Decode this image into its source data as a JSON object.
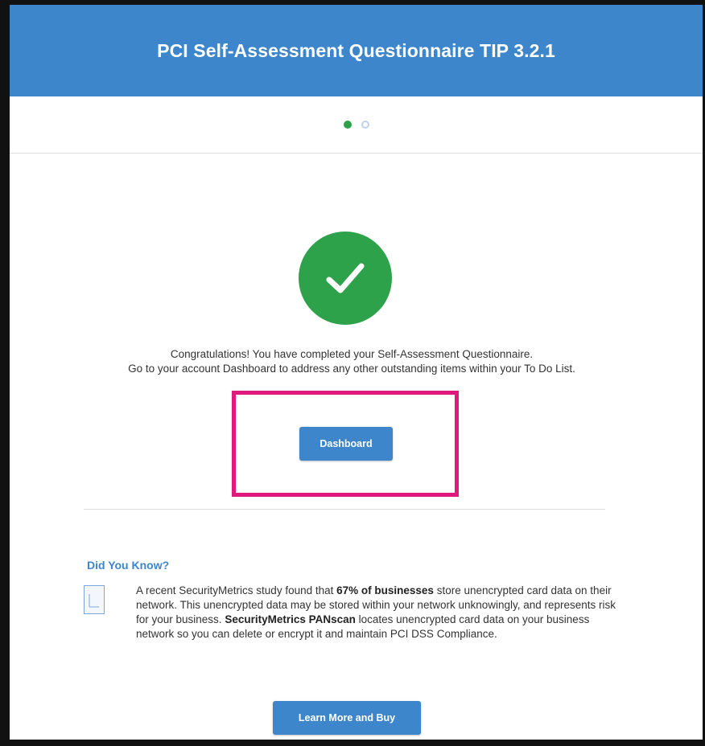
{
  "header": {
    "title": "PCI Self-Assessment Questionnaire TIP 3.2.1"
  },
  "stepper": {
    "steps": [
      {
        "state": "complete"
      },
      {
        "state": "incomplete"
      }
    ]
  },
  "completion": {
    "icon": "checkmark-icon",
    "line1": "Congratulations! You have completed your Self-Assessment Questionnaire.",
    "line2": "Go to your account Dashboard to address any other outstanding items within your To Do List.",
    "dashboard_label": "Dashboard"
  },
  "did_you_know": {
    "title": "Did You Know?",
    "icon": "document-icon",
    "seg1": "A recent SecurityMetrics study found that ",
    "seg2_bold": "67% of businesses",
    "seg3": " store unencrypted card data on their network. This unencrypted data may be stored within your network unknowingly, and represents risk for your business. ",
    "seg4_bold": "SecurityMetrics PANscan",
    "seg5": " locates unencrypted card data on your business network so you can delete or encrypt it and maintain PCI DSS Compliance.",
    "button_label": "Learn More and Buy"
  },
  "colors": {
    "brand_blue": "#3d86cc",
    "success_green": "#2ea14b",
    "highlight_magenta": "#e0197d"
  }
}
